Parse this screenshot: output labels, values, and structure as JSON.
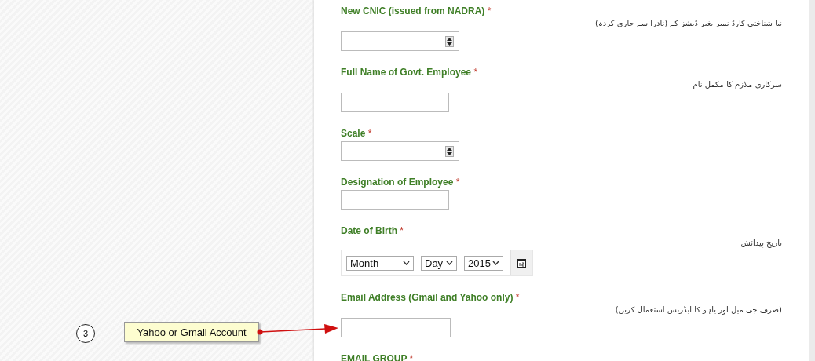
{
  "fields": [
    {
      "kind": "number",
      "label": "New CNIC (issued from NADRA)",
      "required": "*",
      "hint": "نیا شناختی کارڈ نمبر بغیر ڈیشز کے (نادرا سے جاری کردہ)"
    },
    {
      "kind": "text",
      "label": "Full Name of Govt. Employee",
      "required": "*",
      "hint": "سرکاری ملازم کا مکمل نام"
    },
    {
      "kind": "number",
      "label": "Scale",
      "required": "*"
    },
    {
      "kind": "text",
      "label": "Designation of Employee",
      "required": "*"
    },
    {
      "kind": "date",
      "label": "Date of Birth",
      "required": "*",
      "hint": "تاریخ پیدائش",
      "month": "Month",
      "day": "Day",
      "year": "2015"
    },
    {
      "kind": "email",
      "label": "Email Address (Gmail and Yahoo only)",
      "required": "*",
      "hint": "(صرف جی میل اور یاہو کا ایڈریس استعمال کریں)"
    },
    {
      "kind": "heading",
      "label": "EMAIL GROUP",
      "required": "*"
    }
  ],
  "annotation": {
    "step": "3",
    "note": "Yahoo or Gmail Account"
  }
}
